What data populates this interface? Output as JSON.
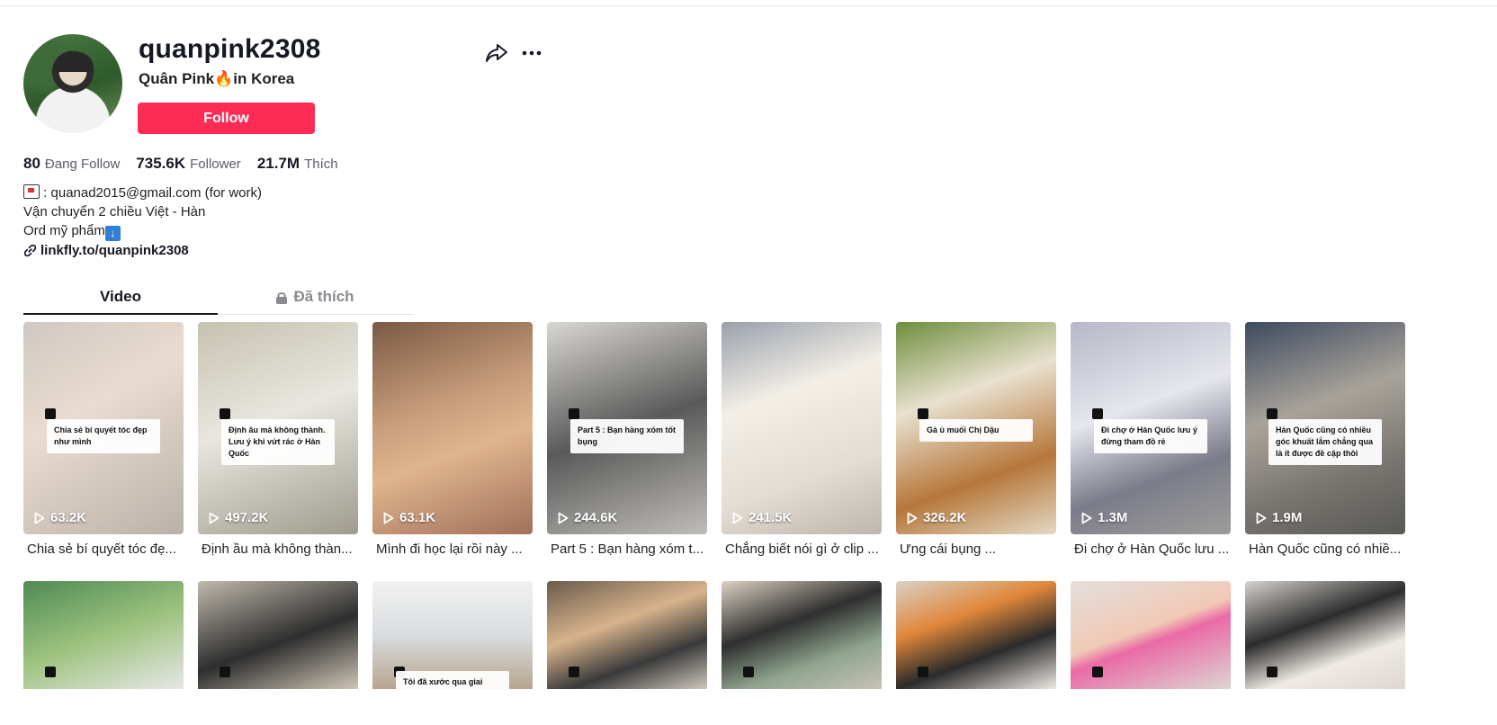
{
  "profile": {
    "username": "quanpink2308",
    "nickname": "Quân Pink🔥in Korea",
    "follow_label": "Follow",
    "stats": [
      {
        "value": "80",
        "label": "Đang Follow"
      },
      {
        "value": "735.6K",
        "label": "Follower"
      },
      {
        "value": "21.7M",
        "label": "Thích"
      }
    ],
    "bio_line1": ": quanad2015@gmail.com (for work)",
    "bio_line2": "Vận chuyển 2 chiều Việt - Hàn",
    "bio_line3": "Ord mỹ phẩm",
    "link": "linkfly.to/quanpink2308"
  },
  "tabs": {
    "video": "Video",
    "liked": "Đã thích"
  },
  "videos": [
    {
      "views": "63.2K",
      "desc": "Chia sẻ bí quyết tóc đẹ...",
      "caption": "Chia sẻ bí quyết tóc đẹp như mình"
    },
    {
      "views": "497.2K",
      "desc": "Định ầu mà không thàn...",
      "caption": "Định âu mà không thành. Lưu ý khi vứt rác ở Hàn Quốc"
    },
    {
      "views": "63.1K",
      "desc": "Mình đi học lại rồi này ...",
      "caption": ""
    },
    {
      "views": "244.6K",
      "desc": "Part 5 : Bạn hàng xóm t...",
      "caption": "Part 5 : Bạn hàng xóm tốt bụng"
    },
    {
      "views": "241.5K",
      "desc": "Chẳng biết nói gì ở clip ...",
      "caption": ""
    },
    {
      "views": "326.2K",
      "desc": "Ưng cái bụng ...",
      "caption": "Gà ủ muối Chị Dậu"
    },
    {
      "views": "1.3M",
      "desc": "Đi chợ ở Hàn Quốc lưu ...",
      "caption": "Đi chợ ở Hàn Quốc lưu ý đừng tham đồ rẻ"
    },
    {
      "views": "1.9M",
      "desc": "Hàn Quốc cũng có nhiề...",
      "caption": "Hàn Quốc cũng có nhiều góc khuất lắm chẳng qua là ít được đề cập thôi"
    }
  ],
  "videos_row2": [
    {
      "caption": ""
    },
    {
      "caption": ""
    },
    {
      "caption": "Tôi đã xước qua giai"
    },
    {
      "caption": ""
    },
    {
      "caption": ""
    },
    {
      "caption": ""
    },
    {
      "caption": ""
    },
    {
      "caption": ""
    }
  ],
  "colors": {
    "accent": "#fe2c55",
    "text": "#161823"
  }
}
